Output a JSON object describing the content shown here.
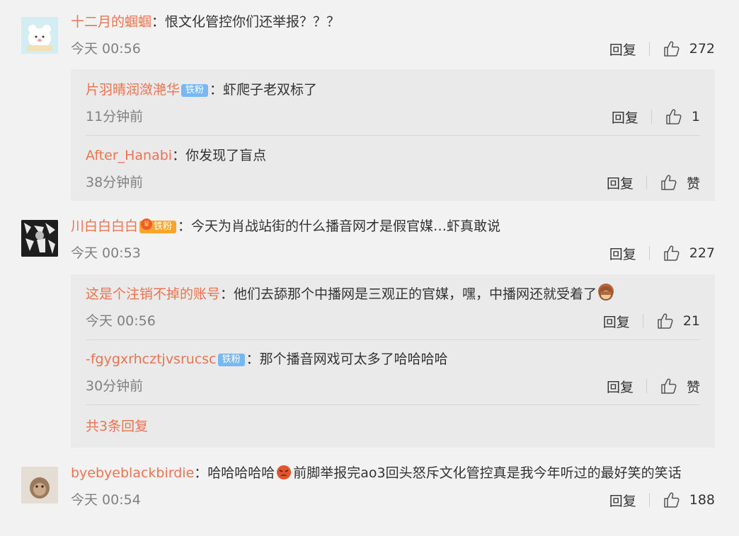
{
  "comments": [
    {
      "user": "十二月的蝈蝈",
      "text": "：恨文化管控你们还举报？？？",
      "time": "今天 00:56",
      "reply_label": "回复",
      "likes": "272",
      "replies": [
        {
          "user": "片羽晴润潋滟华",
          "badge": "铁粉",
          "text": "：虾爬子老双标了",
          "time": "11分钟前",
          "reply_label": "回复",
          "likes": "1"
        },
        {
          "user": "After_Hanabi",
          "text": "：你发现了盲点",
          "time": "38分钟前",
          "reply_label": "回复",
          "likes": "赞"
        }
      ]
    },
    {
      "user": "川白白白白",
      "badge": "铁粉",
      "text": "：今天为肖战站街的什么播音网才是假官媒…虾真敢说",
      "time": "今天 00:53",
      "reply_label": "回复",
      "likes": "227",
      "replies": [
        {
          "user": "这是个注销不掉的账号",
          "text": "：他们去舔那个中播网是三观正的官媒，嘿，中播网还就受着了",
          "time": "今天 00:56",
          "reply_label": "回复",
          "likes": "21"
        },
        {
          "user": "-fgygxrhcztjvsrucsc",
          "badge": "铁粉",
          "text": "：那个播音网戏可太多了哈哈哈哈",
          "time": "30分钟前",
          "reply_label": "回复",
          "likes": "赞"
        }
      ],
      "more_replies": "共3条回复"
    },
    {
      "user": "byebyeblackbirdie",
      "text_part1": "：哈哈哈哈哈",
      "text_part2": "前脚举报完ao3回头怒斥文化管控真是我今年听过的最好笑的笑话",
      "time": "今天 00:54",
      "reply_label": "回复",
      "likes": "188"
    }
  ],
  "colors": {
    "username": "#eb7350",
    "badge_blue": "#77b8f2",
    "badge_orange": "#f9a52c",
    "background": "#f2f2f2",
    "reply_box": "#eaeaea"
  },
  "icons": {
    "like": "thumbs-up-icon",
    "emoji_see_no_evil": "monkey-emoji-icon",
    "emoji_angry": "angry-face-emoji-icon",
    "fan_crown": "crown-icon"
  }
}
